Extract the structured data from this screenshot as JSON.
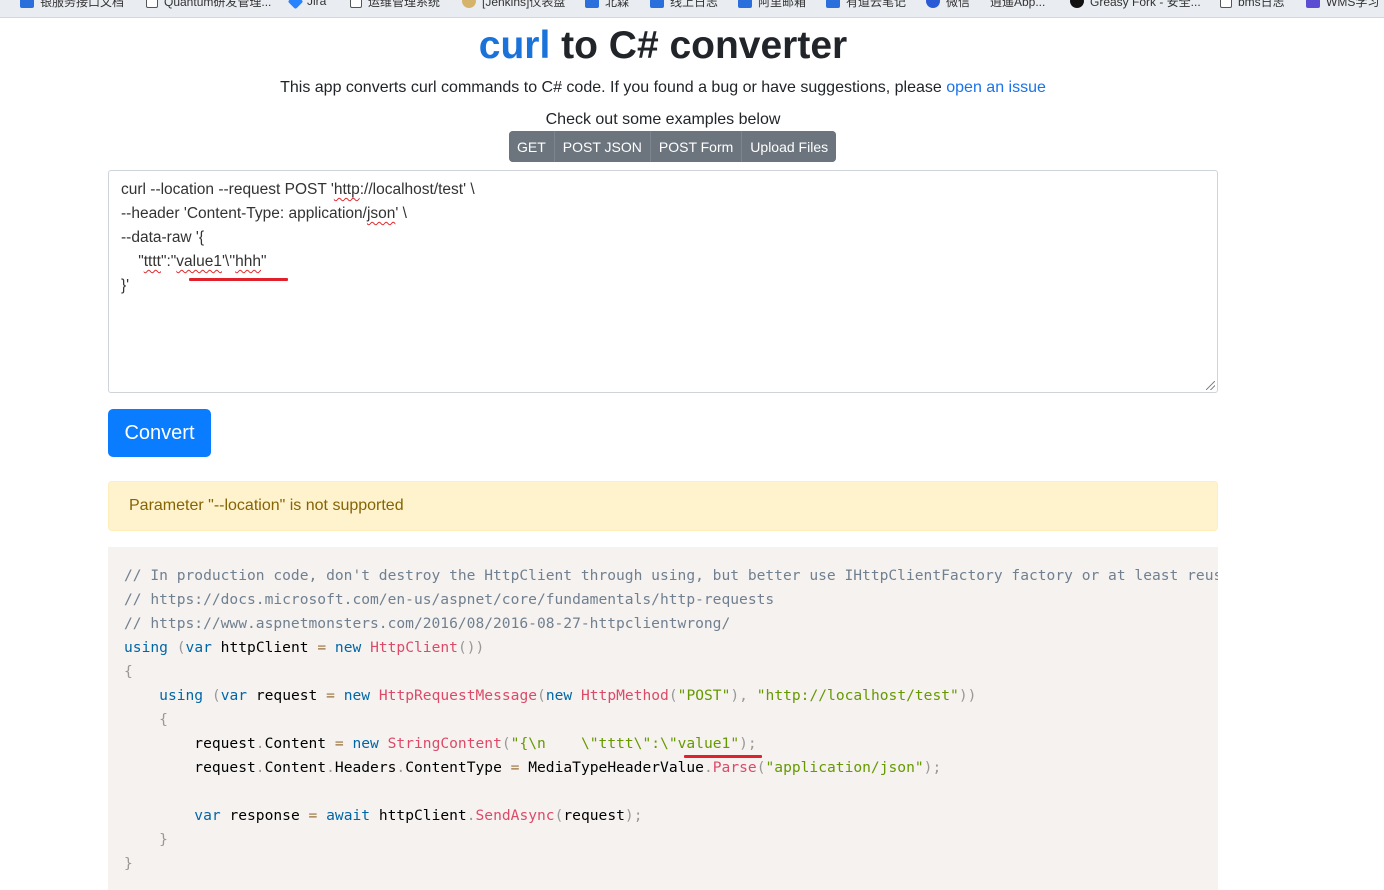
{
  "bookmarks": [
    {
      "label": "银服务接口文档",
      "icon": "blue"
    },
    {
      "label": "Quantum研发管理...",
      "icon": "page"
    },
    {
      "label": "Jira",
      "icon": "diamond"
    },
    {
      "label": "运维管理系统",
      "icon": "page"
    },
    {
      "label": "[Jenkins]仪表盘",
      "icon": "jenkins"
    },
    {
      "label": "北森",
      "icon": "blue"
    },
    {
      "label": "线上日志",
      "icon": "blue"
    },
    {
      "label": "阿里邮箱",
      "icon": "blue"
    },
    {
      "label": "有道云笔记",
      "icon": "blue"
    },
    {
      "label": "微信",
      "icon": "round"
    },
    {
      "label": "逍遥Abp...",
      "icon": "round"
    },
    {
      "label": "Greasy Fork - 安全...",
      "icon": "dark"
    },
    {
      "label": "bms日志",
      "icon": "page"
    },
    {
      "label": "WMS学习",
      "icon": "purple"
    }
  ],
  "header": {
    "title_part1": "curl",
    "title_part2": " to C# converter",
    "description": "This app converts curl commands to C# code. If you found a bug or have suggestions, please ",
    "issue_link": "open an issue"
  },
  "examples": {
    "label": "Check out some examples below",
    "buttons": [
      "GET",
      "POST JSON",
      "POST Form",
      "Upload Files"
    ]
  },
  "editor": {
    "lines": [
      "curl --location --request POST 'http://localhost/test' \\",
      "--header 'Content-Type: application/json' \\",
      "--data-raw '{",
      "    \"tttt\":\"value1'\\''hhh\"",
      "}'"
    ]
  },
  "convert_button": "Convert",
  "alert": {
    "message": "Parameter \"--location\" is not supported",
    "color": "#fff3cd"
  },
  "code_output": {
    "lines": [
      "// In production code, don't destroy the HttpClient through using, but better use IHttpClientFactory factory or at least reuse an existing HttpClient instance",
      "// https://docs.microsoft.com/en-us/aspnet/core/fundamentals/http-requests",
      "// https://www.aspnetmonsters.com/2016/08/2016-08-27-httpclientwrong/",
      "using (var httpClient = new HttpClient())",
      "{",
      "    using (var request = new HttpRequestMessage(new HttpMethod(\"POST\"), \"http://localhost/test\"))",
      "    {",
      "        request.Content = new StringContent(\"{\\n    \\\"tttt\\\":\\\"value1\");",
      "        request.Content.Headers.ContentType = MediaTypeHeaderValue.Parse(\"application/json\");",
      "",
      "        var response = await httpClient.SendAsync(request);",
      "    }",
      "}"
    ]
  },
  "colors": {
    "brand_blue": "#1a73d9",
    "primary_button": "#0a7cff",
    "annotation_red": "#e0202a"
  }
}
